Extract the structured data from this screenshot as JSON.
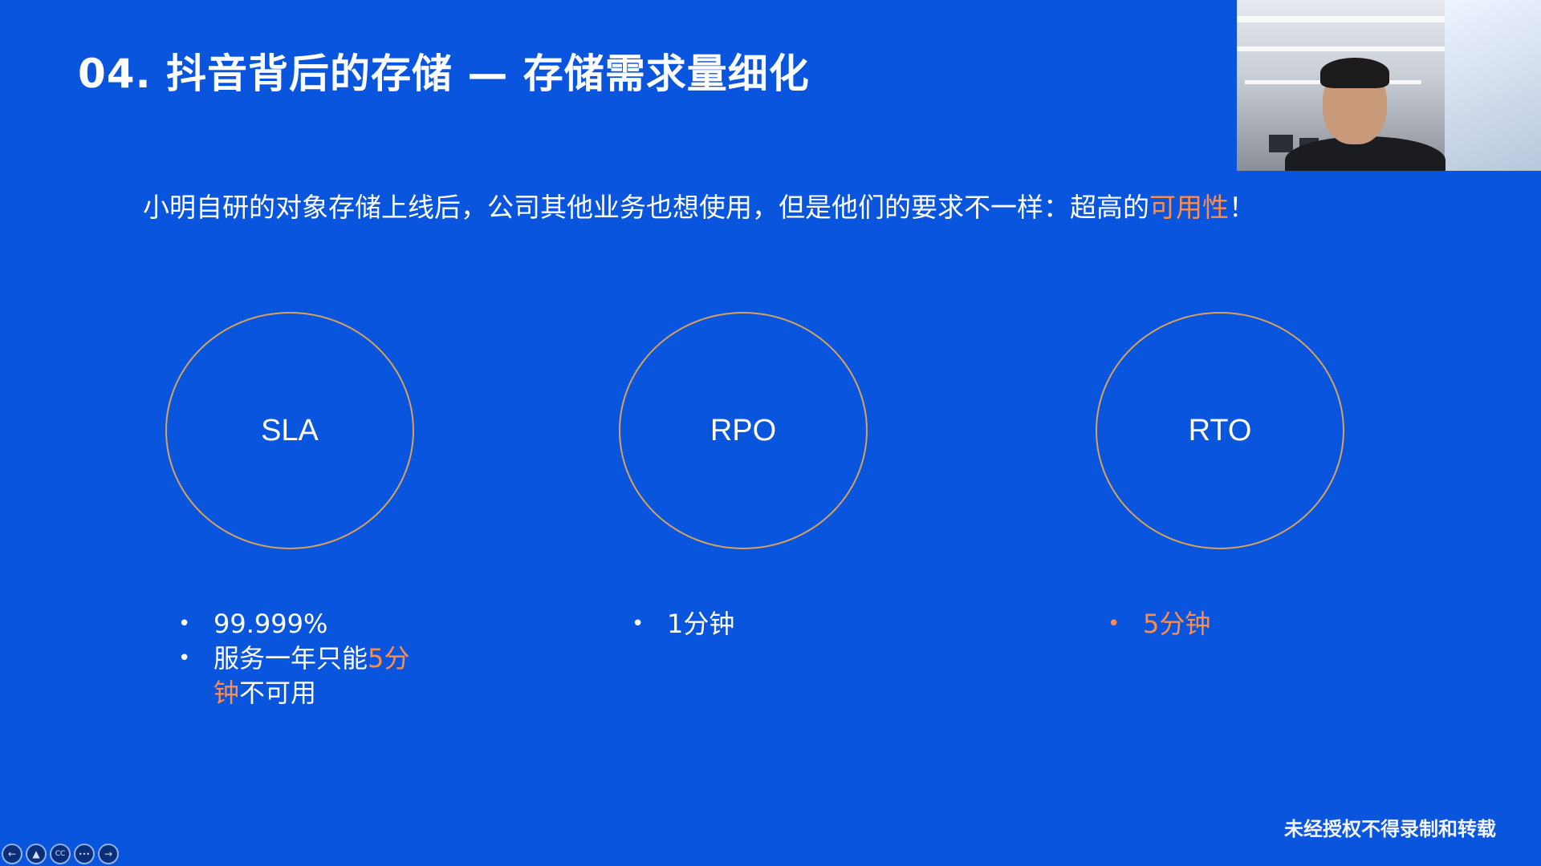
{
  "slide": {
    "title": "04. 抖音背后的存储 — 存储需求量细化",
    "subtitle_prefix": "小明自研的对象存储上线后，公司其他业务也想使用，但是他们的要求不一样：超高的",
    "subtitle_highlight": "可用性",
    "subtitle_suffix": "！",
    "circles": [
      {
        "label": "SLA"
      },
      {
        "label": "RPO"
      },
      {
        "label": "RTO"
      }
    ],
    "sla_bullets": {
      "b1": "99.999%",
      "b2_part1": "服务一年只能",
      "b2_highlight": "5分钟",
      "b2_part2": "不可用"
    },
    "rpo_bullets": {
      "b1": "1分钟"
    },
    "rto_bullets": {
      "b1": "5分钟"
    },
    "bullet_glyph": "•",
    "watermark": "未经授权不得录制和转载",
    "highlight_color": "#ff8c4a",
    "background_color": "#0a55dd"
  },
  "player_controls": {
    "prev_icon": "←",
    "pointer_icon": "▲",
    "cc_icon": "CC",
    "more_icon": "•••",
    "next_icon": "→"
  }
}
